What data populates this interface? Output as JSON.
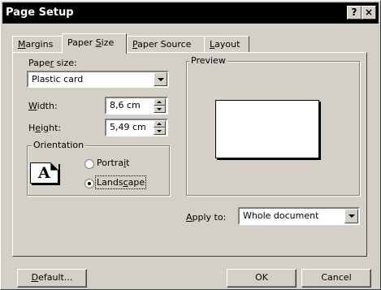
{
  "window": {
    "title": "Page Setup",
    "help_button": "?",
    "close_button": "×"
  },
  "tabs": [
    {
      "label_pre": "",
      "label_key": "M",
      "label_post": "argins",
      "active": false
    },
    {
      "label_pre": "Paper ",
      "label_key": "S",
      "label_post": "ize",
      "active": true
    },
    {
      "label_pre": "",
      "label_key": "P",
      "label_post": "aper Source",
      "active": false
    },
    {
      "label_pre": "",
      "label_key": "L",
      "label_post": "ayout",
      "active": false
    }
  ],
  "paper_size": {
    "label_pre": "Pape",
    "label_key": "r",
    "label_post": " size:",
    "value": "Plastic card"
  },
  "width": {
    "label_pre": "",
    "label_key": "W",
    "label_post": "idth:",
    "value": "8,6 cm"
  },
  "height": {
    "label_pre": "H",
    "label_key": "e",
    "label_post": "ight:",
    "value": "5,49 cm"
  },
  "orientation": {
    "title": "Orientation",
    "icon_letter": "A",
    "portrait": {
      "label_pre": "Portra",
      "label_key": "i",
      "label_post": "t",
      "checked": false
    },
    "landscape": {
      "label_pre": "Lands",
      "label_key": "c",
      "label_post": "ape",
      "checked": true
    }
  },
  "preview": {
    "title": "Preview"
  },
  "apply_to": {
    "label_pre": "",
    "label_key": "A",
    "label_post": "pply to:",
    "value": "Whole document"
  },
  "buttons": {
    "default": {
      "pre": "",
      "key": "D",
      "post": "efault..."
    },
    "ok": "OK",
    "cancel": "Cancel"
  }
}
